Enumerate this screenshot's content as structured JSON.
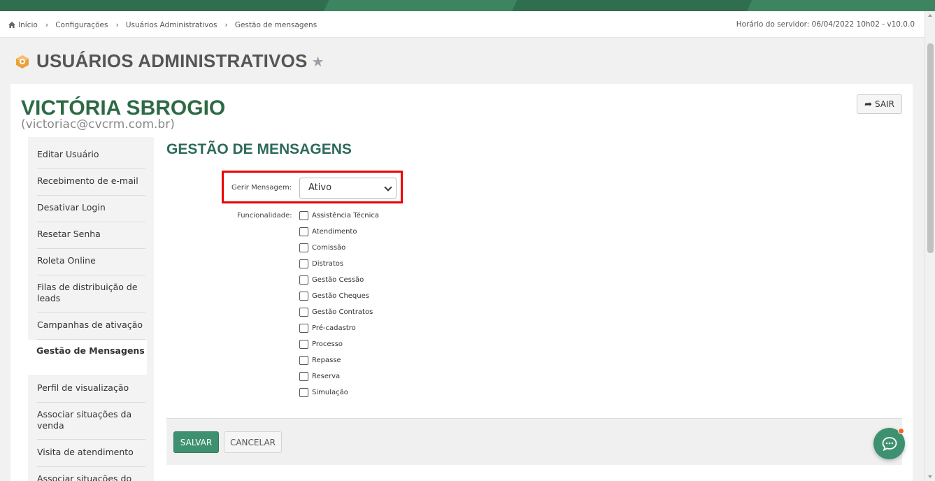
{
  "breadcrumb": {
    "items": [
      "Início",
      "Configurações",
      "Usuários Administrativos",
      "Gestão de mensagens"
    ]
  },
  "server_time": "Horário do servidor: 06/04/2022 10h02 - v10.0.0",
  "page": {
    "title": "USUÁRIOS ADMINISTRATIVOS"
  },
  "user": {
    "name": "VICTÓRIA SBROGIO",
    "email": "(victoriac@cvcrm.com.br)"
  },
  "exit_label": "SAIR",
  "sidebar": {
    "items": [
      {
        "label": "Editar Usuário"
      },
      {
        "label": "Recebimento de e-mail"
      },
      {
        "label": "Desativar Login"
      },
      {
        "label": "Resetar Senha"
      },
      {
        "label": "Roleta Online"
      },
      {
        "label": "Filas de distribuição de leads"
      },
      {
        "label": "Campanhas de ativação"
      },
      {
        "label": "Gestão de Mensagens"
      },
      {
        "label": "Perfil de visualização"
      },
      {
        "label": "Associar situações da venda"
      },
      {
        "label": "Visita de atendimento"
      },
      {
        "label": "Associar situações do"
      }
    ],
    "active": "Gestão de Mensagens"
  },
  "section": {
    "title": "GESTÃO DE MENSAGENS"
  },
  "form": {
    "gerir_label": "Gerir Mensagem:",
    "gerir_value": "Ativo",
    "func_label": "Funcionalidade:",
    "functions": [
      {
        "label": "Assistência Técnica",
        "checked": false
      },
      {
        "label": "Atendimento",
        "checked": false
      },
      {
        "label": "Comissão",
        "checked": false
      },
      {
        "label": "Distratos",
        "checked": false
      },
      {
        "label": "Gestão Cessão",
        "checked": false
      },
      {
        "label": "Gestão Cheques",
        "checked": false
      },
      {
        "label": "Gestão Contratos",
        "checked": false
      },
      {
        "label": "Pré-cadastro",
        "checked": false
      },
      {
        "label": "Processo",
        "checked": false
      },
      {
        "label": "Repasse",
        "checked": false
      },
      {
        "label": "Reserva",
        "checked": false
      },
      {
        "label": "Simulação",
        "checked": false
      }
    ]
  },
  "actions": {
    "save": "SALVAR",
    "cancel": "CANCELAR"
  },
  "colors": {
    "brand_green": "#2d6a45",
    "button_green": "#3e9170",
    "highlight_red": "#ee0000",
    "notification_orange": "#f26522"
  },
  "icons": {
    "home": "home-icon",
    "module": "module-icon",
    "favorite": "star-icon",
    "exit": "share-icon",
    "chat": "chat-icon"
  }
}
